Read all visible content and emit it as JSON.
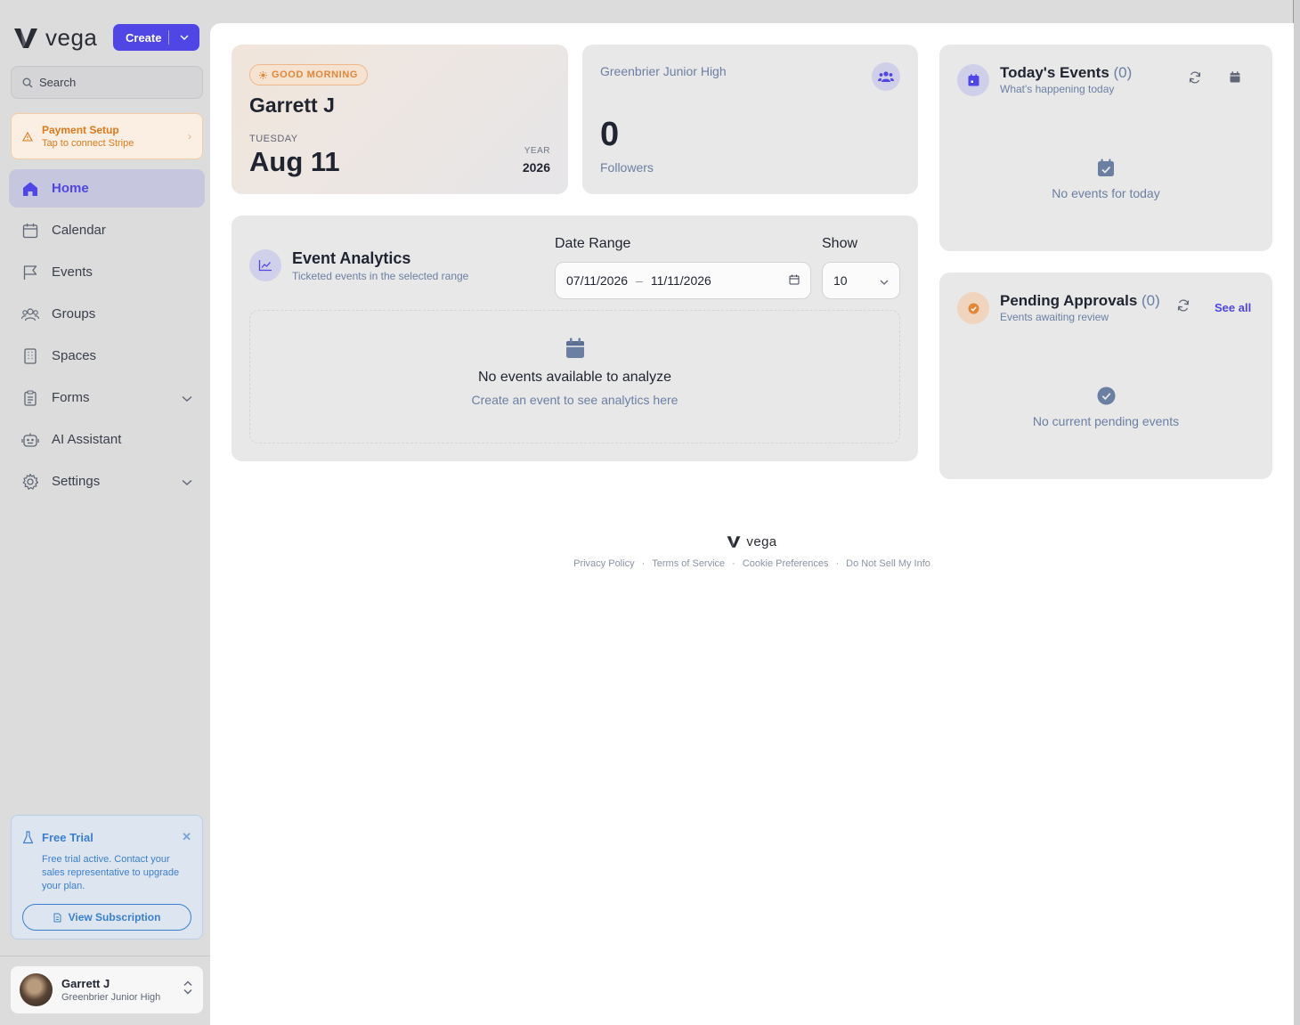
{
  "brand": {
    "name": "vega"
  },
  "create_button": {
    "label": "Create"
  },
  "search": {
    "placeholder": "Search"
  },
  "payment_setup": {
    "title": "Payment Setup",
    "subtitle": "Tap to connect Stripe"
  },
  "nav": {
    "items": [
      {
        "label": "Home",
        "icon": "home-icon",
        "active": true
      },
      {
        "label": "Calendar",
        "icon": "calendar-icon"
      },
      {
        "label": "Events",
        "icon": "flag-icon"
      },
      {
        "label": "Groups",
        "icon": "users-icon"
      },
      {
        "label": "Spaces",
        "icon": "building-icon"
      },
      {
        "label": "Forms",
        "icon": "clipboard-icon",
        "expandable": true
      },
      {
        "label": "AI Assistant",
        "icon": "robot-icon"
      },
      {
        "label": "Settings",
        "icon": "gear-icon",
        "expandable": true
      }
    ]
  },
  "free_trial": {
    "title": "Free Trial",
    "body": "Free trial active. Contact your sales representative to upgrade your plan.",
    "button": "View Subscription"
  },
  "user": {
    "name": "Garrett J",
    "org": "Greenbrier Junior High"
  },
  "greeting": {
    "badge": "GOOD MORNING",
    "name": "Garrett J",
    "day_of_week": "TUESDAY",
    "date": "Aug 11",
    "year_label": "YEAR",
    "year": "2026"
  },
  "followers": {
    "org": "Greenbrier Junior High",
    "count": "0",
    "label": "Followers"
  },
  "analytics": {
    "title": "Event Analytics",
    "subtitle": "Ticketed events in the selected range",
    "date_range_label": "Date Range",
    "date_start": "07/11/2026",
    "date_sep": "–",
    "date_end": "11/11/2026",
    "show_label": "Show",
    "show_value": "10",
    "empty_title": "No events available to analyze",
    "empty_sub": "Create an event to see analytics here"
  },
  "today_events": {
    "title": "Today's Events",
    "count": "(0)",
    "subtitle": "What's happening today",
    "empty": "No events for today"
  },
  "pending_approvals": {
    "title": "Pending Approvals",
    "count": "(0)",
    "subtitle": "Events awaiting review",
    "see_all": "See all",
    "empty": "No current pending events"
  },
  "footer": {
    "brand": "vega",
    "links": [
      "Privacy Policy",
      "Terms of Service",
      "Cookie Preferences",
      "Do Not Sell My Info"
    ],
    "separator": "·"
  },
  "colors": {
    "accent": "#4f46e5",
    "warning": "#dd7a1d",
    "info": "#3b7ed0",
    "muted": "#6b7fa3"
  }
}
